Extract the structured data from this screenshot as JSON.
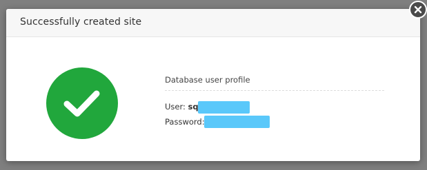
{
  "dialog": {
    "title": "Successfully created site",
    "section_heading": "Database user profile",
    "user_label": "User:",
    "user_value_visible": "sql",
    "password_label": "Password:"
  },
  "colors": {
    "success": "#21a73c",
    "redaction": "#5ac8fa"
  },
  "icons": {
    "status": "checkmark-icon",
    "close": "close-icon"
  }
}
